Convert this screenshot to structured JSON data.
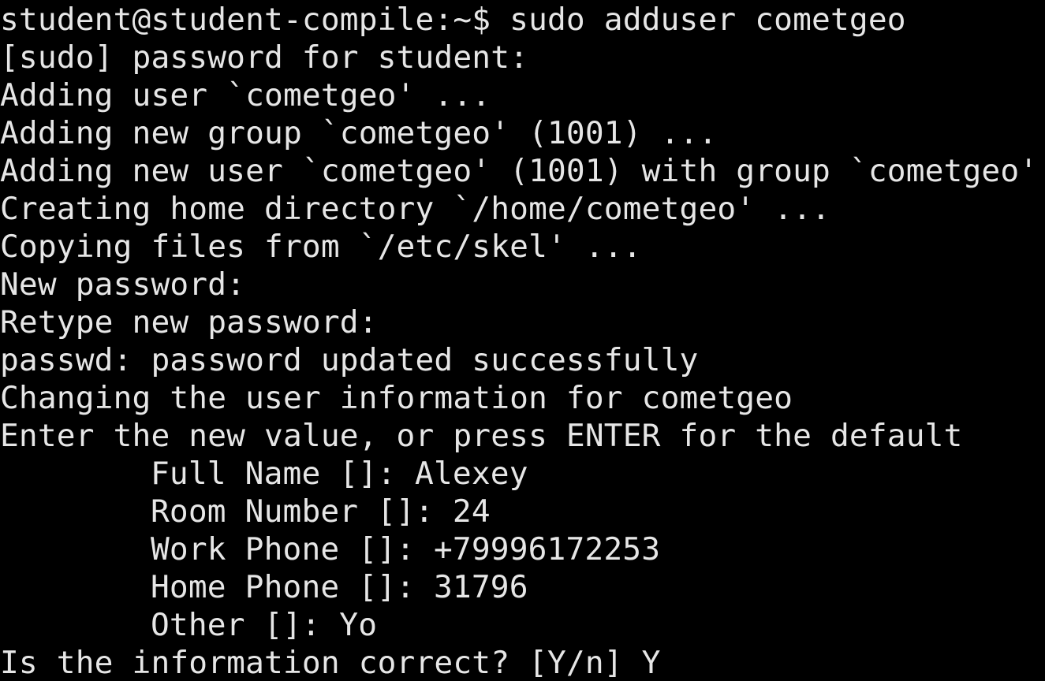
{
  "terminal": {
    "foreground": "#e6e6e6",
    "background": "#000000",
    "prompt": "student@student-compile:~$ ",
    "command": "sudo adduser cometgeo",
    "output": [
      "[sudo] password for student:",
      "Adding user `cometgeo' ...",
      "Adding new group `cometgeo' (1001) ...",
      "Adding new user `cometgeo' (1001) with group `cometgeo'",
      "Creating home directory `/home/cometgeo' ...",
      "Copying files from `/etc/skel' ...",
      "New password:",
      "Retype new password:",
      "passwd: password updated successfully",
      "Changing the user information for cometgeo",
      "Enter the new value, or press ENTER for the default"
    ],
    "fields": [
      "Full Name []: Alexey",
      "Room Number []: 24",
      "Work Phone []: +79996172253",
      "Home Phone []: 31796",
      "Other []: Yo"
    ],
    "confirm": "Is the information correct? [Y/n] Y"
  }
}
